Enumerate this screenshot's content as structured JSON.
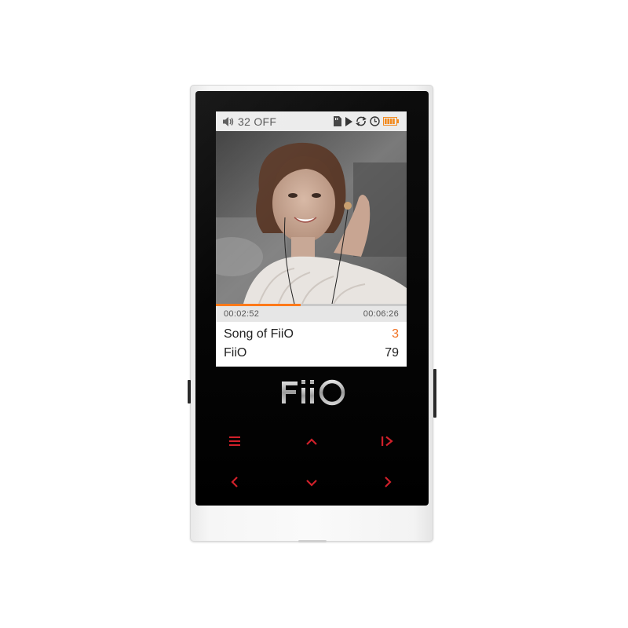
{
  "status": {
    "volume_icon": "speaker-icon",
    "volume_text": "32 OFF",
    "icons": [
      "sd-card-icon",
      "play-icon",
      "repeat-icon",
      "clock-icon",
      "battery-icon"
    ],
    "battery_color": "#f28a1e"
  },
  "player": {
    "elapsed": "00:02:52",
    "total": "00:06:26",
    "progress": 0.445,
    "title": "Song of FiiO",
    "track_number": "3",
    "artist": "FiiO",
    "track_count": "79",
    "accent_color": "#ff7a1a"
  },
  "device": {
    "logo_text": "FiiO",
    "buttons": [
      {
        "name": "menu-button",
        "icon": "menu-icon"
      },
      {
        "name": "up-button",
        "icon": "chevron-up-icon"
      },
      {
        "name": "play-pause-button",
        "icon": "play-pause-icon"
      },
      {
        "name": "back-button",
        "icon": "chevron-left-icon"
      },
      {
        "name": "down-button",
        "icon": "chevron-down-icon"
      },
      {
        "name": "forward-button",
        "icon": "chevron-right-icon"
      }
    ],
    "button_color": "#d0202a"
  }
}
